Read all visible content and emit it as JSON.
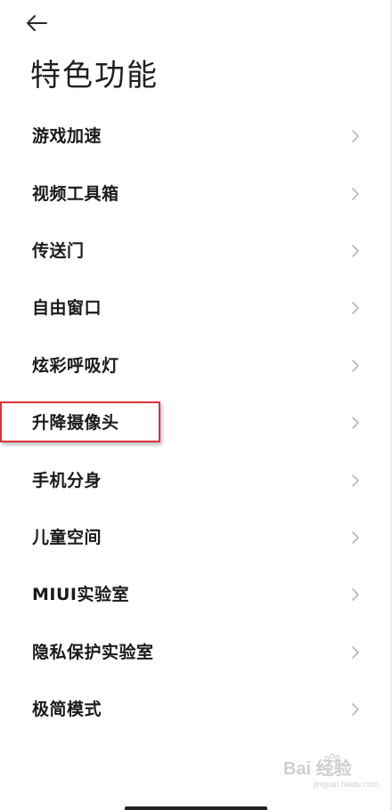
{
  "header": {
    "back_icon": "arrow-left-icon",
    "title": "特色功能"
  },
  "menu": {
    "items": [
      {
        "label": "游戏加速"
      },
      {
        "label": "视频工具箱"
      },
      {
        "label": "传送门"
      },
      {
        "label": "自由窗口"
      },
      {
        "label": "炫彩呼吸灯"
      },
      {
        "label": "升降摄像头"
      },
      {
        "label": "手机分身"
      },
      {
        "label": "儿童空间"
      },
      {
        "label": "MIUI实验室"
      },
      {
        "label": "隐私保护实验室"
      },
      {
        "label": "极简模式"
      }
    ]
  },
  "annotation": {
    "highlighted_item": "升降摄像头",
    "color": "#d9343a"
  },
  "watermark": {
    "text": "Bai 经验",
    "subtext": "jingyan.baidu.com"
  },
  "colors": {
    "background": "#ffffff",
    "text": "#1a1a1a",
    "chevron": "#b8b8b8"
  }
}
